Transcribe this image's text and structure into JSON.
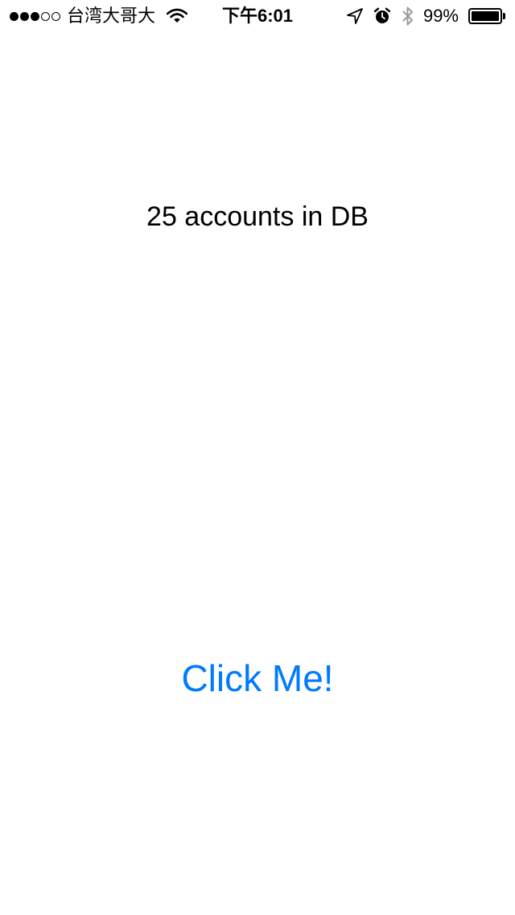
{
  "status_bar": {
    "signal_strength": 3,
    "signal_max": 5,
    "carrier": "台湾大哥大",
    "time": "下午6:01",
    "battery_percent": "99%",
    "battery_level": 0.99,
    "icons": [
      "wifi-icon",
      "location-arrow-icon",
      "alarm-clock-icon",
      "bluetooth-icon",
      "battery-icon"
    ]
  },
  "main": {
    "accounts_text": "25 accounts in DB",
    "button_label": "Click Me!"
  },
  "colors": {
    "background": "#ffffff",
    "text": "#000000",
    "button_tint": "#007aff"
  }
}
